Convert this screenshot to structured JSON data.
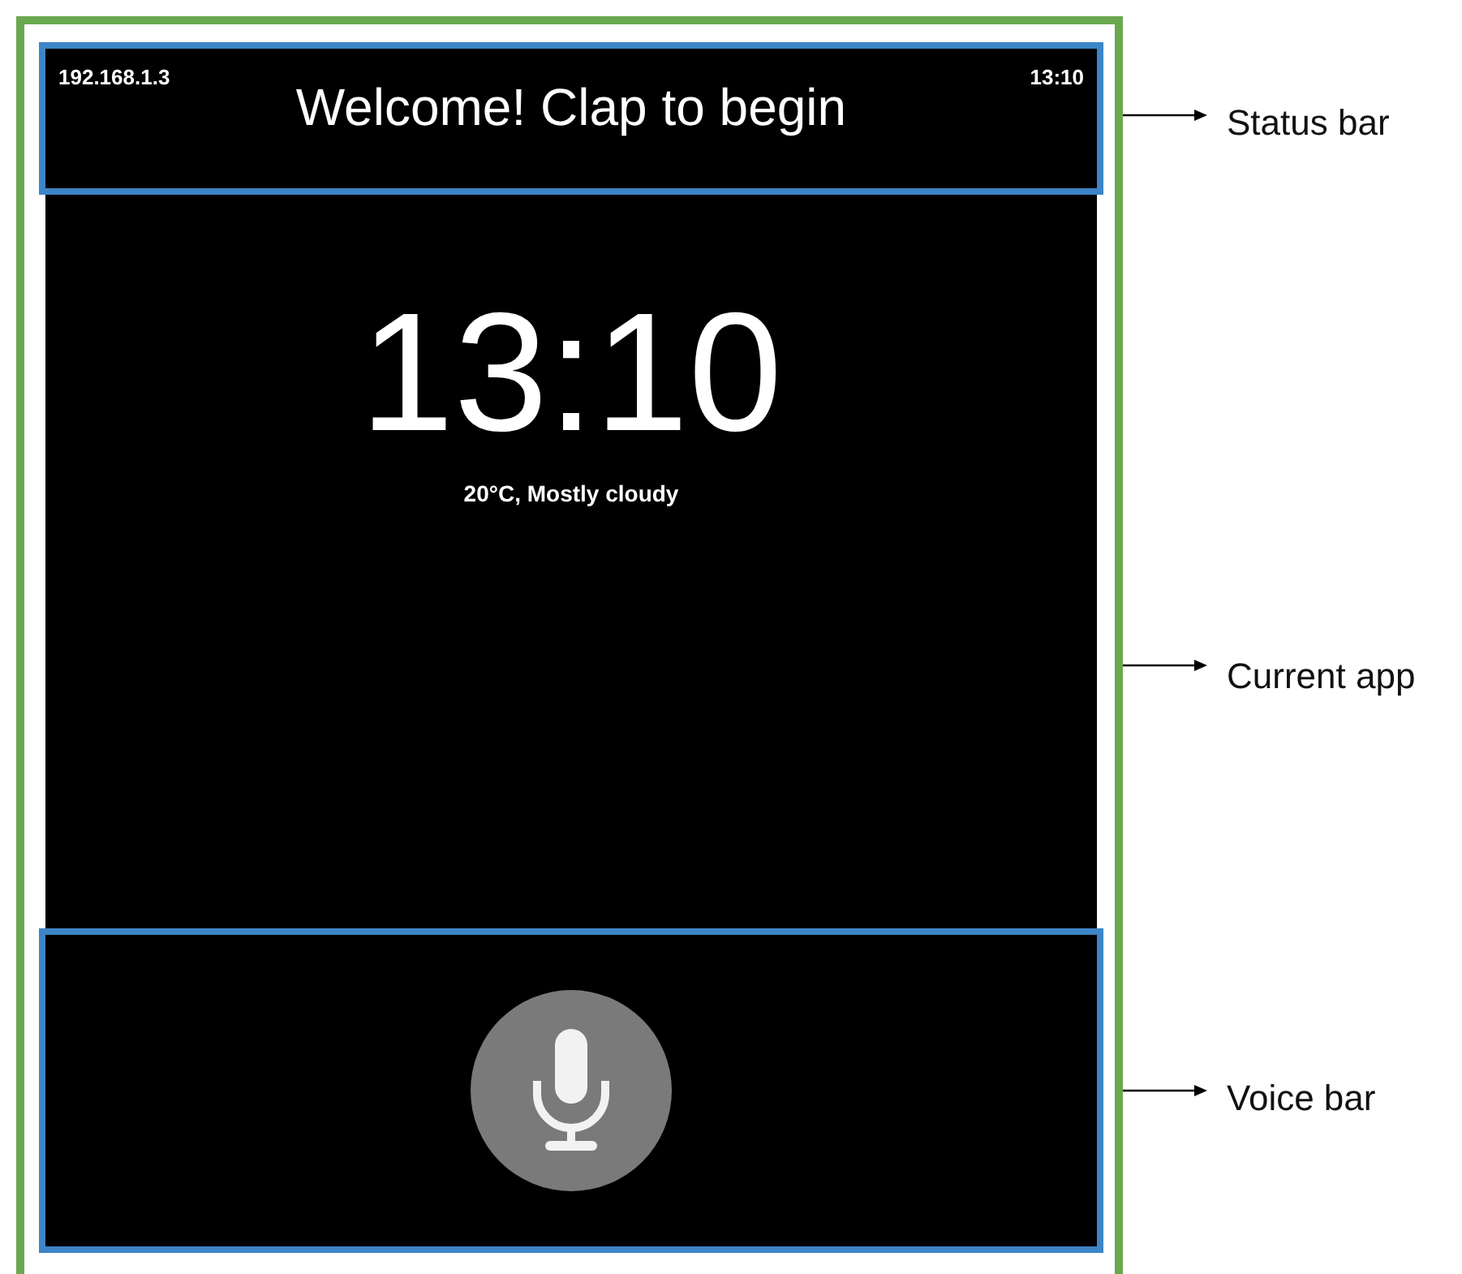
{
  "status_bar": {
    "ip_address": "192.168.1.3",
    "message": "Welcome! Clap to begin",
    "time": "13:10"
  },
  "current_app": {
    "clock": "13:10",
    "weather": "20°C, Mostly cloudy"
  },
  "annotations": [
    {
      "label": "Status bar"
    },
    {
      "label": "Current app"
    },
    {
      "label": "Voice bar"
    }
  ]
}
